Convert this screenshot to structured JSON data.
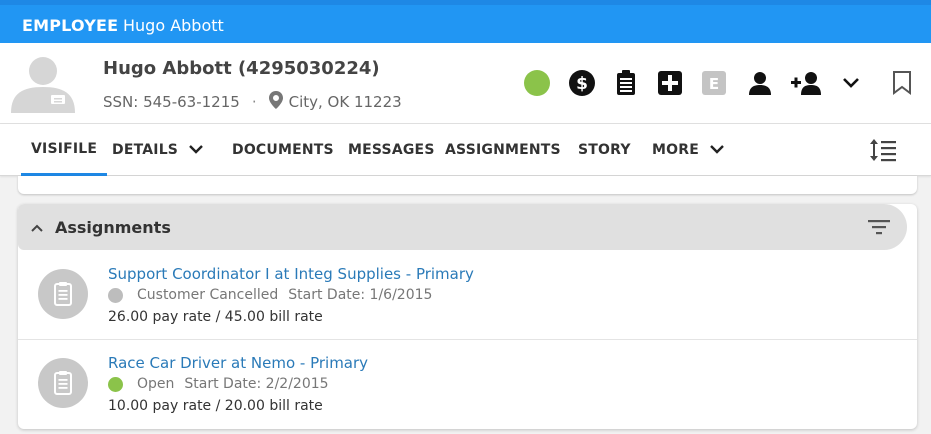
{
  "topbar": {
    "kind": "EMPLOYEE",
    "name": "Hugo Abbott"
  },
  "employee": {
    "name_with_id": "Hugo Abbott (4295030224)",
    "ssn": "SSN: 545-63-1215",
    "separator": "·",
    "location": "City, OK 11223"
  },
  "header_icons": [
    {
      "name": "status-dot-icon",
      "color": "#8bc34a"
    },
    {
      "name": "dollar-icon"
    },
    {
      "name": "clipboard-icon"
    },
    {
      "name": "medical-cross-icon"
    },
    {
      "name": "e-verify-icon",
      "label": "E"
    },
    {
      "name": "person-icon"
    },
    {
      "name": "person-add-icon"
    },
    {
      "name": "chevron-down-icon"
    },
    {
      "name": "bookmark-icon"
    }
  ],
  "tabs": [
    {
      "label": "VISIFILE",
      "active": true
    },
    {
      "label": "DETAILS",
      "has_menu": true
    },
    {
      "label": "DOCUMENTS"
    },
    {
      "label": "MESSAGES"
    },
    {
      "label": "ASSIGNMENTS"
    },
    {
      "label": "STORY"
    },
    {
      "label": "MORE",
      "has_menu": true
    }
  ],
  "assignments": {
    "title": "Assignments",
    "items": [
      {
        "title": "Support Coordinator I at Integ Supplies - Primary",
        "status": "Customer Cancelled",
        "status_color": "#bdbdbd",
        "start": "Start Date: 1/6/2015",
        "rates": "26.00 pay rate / 45.00 bill rate"
      },
      {
        "title": "Race Car Driver at Nemo - Primary",
        "status": "Open",
        "status_color": "#8bc34a",
        "start": "Start Date: 2/2/2015",
        "rates": "10.00 pay rate / 20.00 bill rate"
      }
    ]
  },
  "colors": {
    "topbar": "#2196f3",
    "accent": "#1e88e5",
    "link": "#2a7ab8"
  }
}
